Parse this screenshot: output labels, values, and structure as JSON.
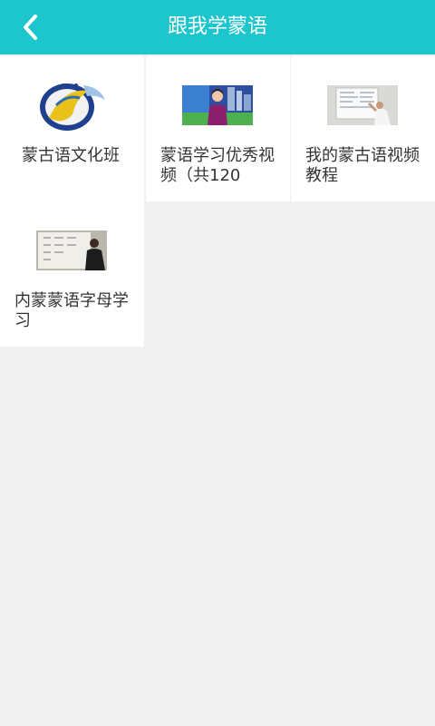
{
  "header": {
    "title": "跟我学蒙语",
    "back_icon": "chevron-left-icon"
  },
  "courses": [
    {
      "title": "蒙古语文化班",
      "thumbnail": "mongolian-emblem-image"
    },
    {
      "title": "蒙语学习优秀视频（共120",
      "thumbnail": "presenter-video-image"
    },
    {
      "title": "我的蒙古语视频教程",
      "thumbnail": "whiteboard-teacher-image"
    },
    {
      "title": "内蒙蒙语字母学习",
      "thumbnail": "alphabet-lesson-image"
    }
  ],
  "colors": {
    "header": "#1dc5cd",
    "background": "#f0f0f0",
    "card": "#ffffff",
    "text": "#333333"
  }
}
